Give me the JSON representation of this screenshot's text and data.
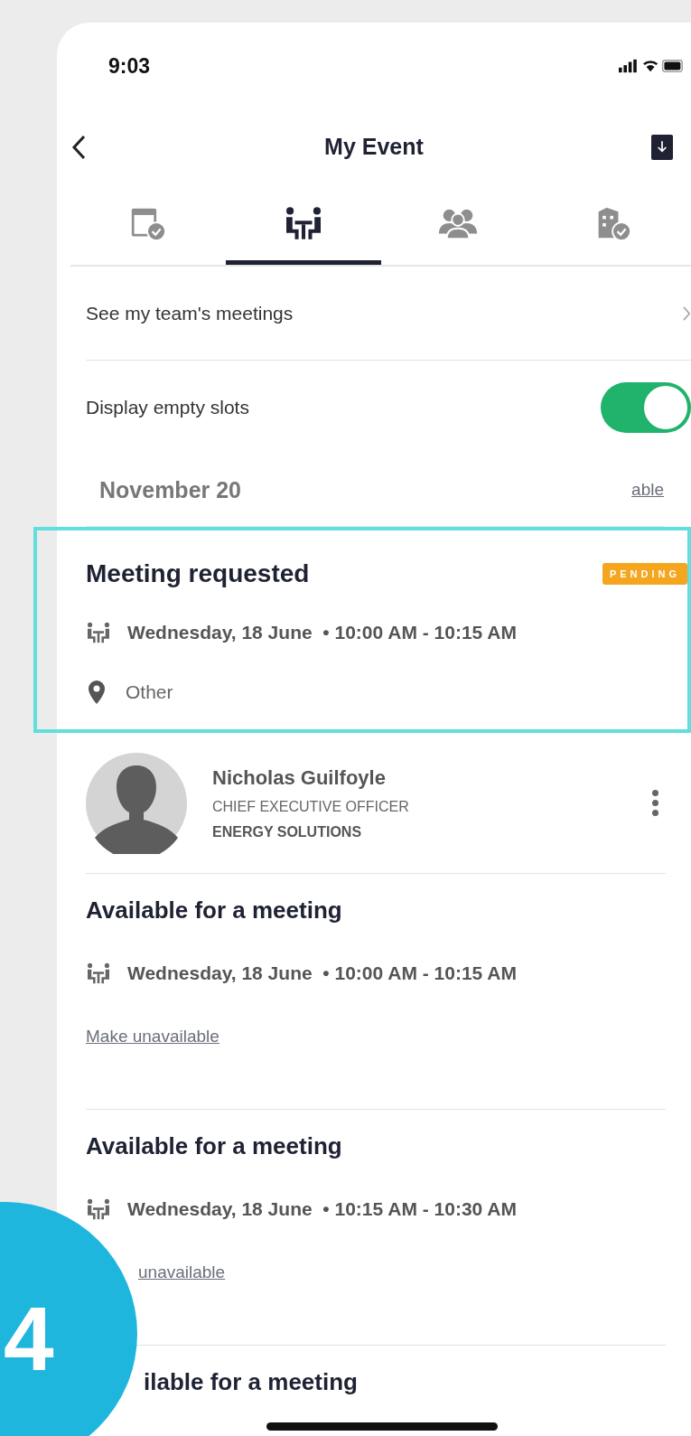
{
  "status_bar": {
    "time": "9:03"
  },
  "header": {
    "title": "My Event"
  },
  "tabs": [
    {
      "kind": "calendar",
      "selected": false
    },
    {
      "kind": "meeting",
      "selected": true
    },
    {
      "kind": "people",
      "selected": false
    },
    {
      "kind": "building",
      "selected": false
    }
  ],
  "settings": [
    {
      "kind": "link",
      "label": "See my team's meetings"
    },
    {
      "kind": "toggle",
      "label": "Display empty slots",
      "on": true
    }
  ],
  "date_header": {
    "title": "November 20",
    "link": "able"
  },
  "meetings": [
    {
      "kind": "request",
      "highlighted": true,
      "title": "Meeting requested",
      "badge": "PENDING",
      "when": "Wednesday, 18 June  • 10:00 AM - 10:15 AM",
      "location": "Other",
      "contact": {
        "name": "Nicholas Guilfoyle",
        "role": "CHIEF EXECUTIVE OFFICER",
        "company": "ENERGY SOLUTIONS"
      }
    },
    {
      "kind": "slot",
      "title": "Available for a meeting",
      "when": "Wednesday, 18 June  • 10:00 AM - 10:15 AM",
      "action": "Make unavailable"
    },
    {
      "kind": "slot",
      "title": "Available for a meeting",
      "when": "Wednesday, 18 June  • 10:15 AM - 10:30 AM",
      "action": "unavailable",
      "action_cut": true
    },
    {
      "kind": "slot",
      "title": "ilable for a meeting",
      "title_cut": true
    }
  ],
  "step_badge": "4"
}
